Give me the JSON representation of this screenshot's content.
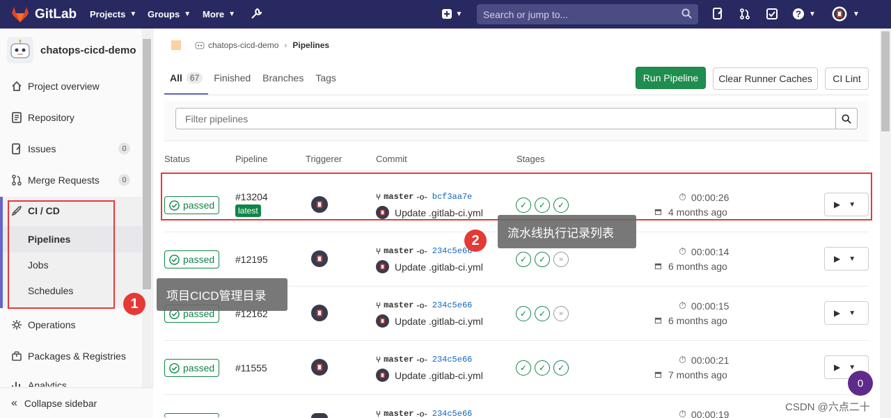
{
  "topbar": {
    "brand": "GitLab",
    "nav": [
      "Projects",
      "Groups",
      "More"
    ],
    "search_placeholder": "Search or jump to...",
    "colors": {
      "bg": "#292961",
      "search_bg": "#4c4c84"
    }
  },
  "sidebar": {
    "project_name": "chatops-cicd-demo",
    "items": [
      {
        "label": "Project overview",
        "icon": "home-icon"
      },
      {
        "label": "Repository",
        "icon": "doc-icon"
      },
      {
        "label": "Issues",
        "icon": "issues-icon",
        "badge": "0"
      },
      {
        "label": "Merge Requests",
        "icon": "merge-request-icon",
        "badge": "0"
      },
      {
        "label": "CI / CD",
        "icon": "rocket-icon"
      },
      {
        "label": "Operations",
        "icon": "cloud-gear-icon"
      },
      {
        "label": "Packages & Registries",
        "icon": "package-icon"
      },
      {
        "label": "Analytics",
        "icon": "chart-icon"
      }
    ],
    "cicd_sub": [
      "Pipelines",
      "Jobs",
      "Schedules"
    ],
    "collapse_label": "Collapse sidebar"
  },
  "breadcrumb": {
    "project": "chatops-cicd-demo",
    "current": "Pipelines"
  },
  "tabs": [
    {
      "label": "All",
      "count": "67"
    },
    {
      "label": "Finished"
    },
    {
      "label": "Branches"
    },
    {
      "label": "Tags"
    }
  ],
  "buttons": {
    "run": "Run Pipeline",
    "clear": "Clear Runner Caches",
    "lint": "CI Lint"
  },
  "filter_placeholder": "Filter pipelines",
  "columns": [
    "Status",
    "Pipeline",
    "Triggerer",
    "Commit",
    "Stages"
  ],
  "pipelines": [
    {
      "status": "passed",
      "id": "#13204",
      "latest": "latest",
      "ref": "master",
      "sha": "bcf3aa7e",
      "message": "Update .gitlab-ci.yml",
      "stages": [
        "success",
        "success",
        "success"
      ],
      "duration": "00:00:26",
      "ago": "4 months ago"
    },
    {
      "status": "passed",
      "id": "#12195",
      "ref": "master",
      "sha": "234c5e66",
      "message": "Update .gitlab-ci.yml",
      "stages": [
        "success",
        "success",
        "skipped"
      ],
      "duration": "00:00:14",
      "ago": "6 months ago"
    },
    {
      "status": "passed",
      "id": "#12162",
      "ref": "master",
      "sha": "234c5e66",
      "message": "Update .gitlab-ci.yml",
      "stages": [
        "success",
        "success",
        "skipped"
      ],
      "duration": "00:00:15",
      "ago": "6 months ago"
    },
    {
      "status": "passed",
      "id": "#11555",
      "ref": "master",
      "sha": "234c5e66",
      "message": "Update .gitlab-ci.yml",
      "stages": [
        "success",
        "success",
        "success"
      ],
      "duration": "00:00:21",
      "ago": "7 months ago"
    },
    {
      "status": "passed",
      "ref": "master",
      "sha": "234c5e66",
      "duration": "00:00:19"
    }
  ],
  "annotations": {
    "callout1": "项目CICD管理目录",
    "callout2": "流水线执行记录列表",
    "num1": "1",
    "num2": "2",
    "highlight_color": "#e53935"
  },
  "fab_count": "0",
  "watermark": "CSDN @六点二十"
}
